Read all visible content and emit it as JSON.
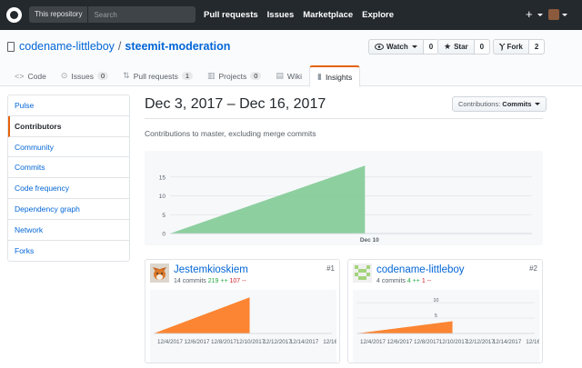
{
  "header": {
    "search_scope": "This repository",
    "search_placeholder": "Search",
    "nav": [
      "Pull requests",
      "Issues",
      "Marketplace",
      "Explore"
    ],
    "plus_icon": "plus-icon",
    "avatar_icon": "user-avatar"
  },
  "repo": {
    "owner": "codename-littleboy",
    "separator": "/",
    "name": "steemit-moderation",
    "watch_label": "Watch",
    "watch_count": "0",
    "star_label": "Star",
    "star_count": "0",
    "fork_label": "Fork",
    "fork_count": "2"
  },
  "tabs": [
    {
      "label": "Code",
      "icon": "code-icon",
      "count": null
    },
    {
      "label": "Issues",
      "icon": "issue-icon",
      "count": "0"
    },
    {
      "label": "Pull requests",
      "icon": "pull-request-icon",
      "count": "1"
    },
    {
      "label": "Projects",
      "icon": "project-icon",
      "count": "0"
    },
    {
      "label": "Wiki",
      "icon": "book-icon",
      "count": null
    },
    {
      "label": "Insights",
      "icon": "graph-icon",
      "count": null,
      "active": true
    }
  ],
  "sidebar": {
    "items": [
      {
        "label": "Pulse"
      },
      {
        "label": "Contributors",
        "selected": true
      },
      {
        "label": "Community"
      },
      {
        "label": "Commits"
      },
      {
        "label": "Code frequency"
      },
      {
        "label": "Dependency graph"
      },
      {
        "label": "Network"
      },
      {
        "label": "Forks"
      }
    ]
  },
  "main": {
    "date_range": "Dec 3, 2017 – Dec 16, 2017",
    "contrib_label": "Contributions:",
    "contrib_value": "Commits",
    "subtitle": "Contributions to master, excluding merge commits"
  },
  "colors": {
    "accent": "#e36209",
    "link": "#0366d6",
    "main_area": "#7bc88f",
    "user_area": "#fb8532",
    "additions": "#28a745",
    "deletions": "#cb2431"
  },
  "chart_data": [
    {
      "type": "area",
      "title": "",
      "x": [
        "2017-12-03",
        "2017-12-10"
      ],
      "y": [
        0,
        18
      ],
      "x_tick_labels": [
        "Dec 10"
      ],
      "y_ticks": [
        0,
        5,
        10,
        15
      ],
      "ylim": [
        0,
        20
      ],
      "grid": true
    },
    {
      "type": "area",
      "name": "Jestemkioskiem",
      "x": [
        "2017-12-03",
        "2017-12-10"
      ],
      "y": [
        0,
        14
      ],
      "x_tick_labels": [
        "12/4/2017",
        "12/6/2017",
        "12/8/2017",
        "12/10/2017",
        "12/12/2017",
        "12/14/2017",
        "12/16/"
      ]
    },
    {
      "type": "area",
      "name": "codename-littleboy",
      "x": [
        "2017-12-03",
        "2017-12-10"
      ],
      "y": [
        0,
        4
      ],
      "y_ticks": [
        5,
        10
      ],
      "x_tick_labels": [
        "12/4/2017",
        "12/6/2017",
        "12/8/2017",
        "12/10/2017",
        "12/12/2017",
        "12/14/2017",
        "12/16/"
      ]
    }
  ],
  "contributors": [
    {
      "name": "Jestemkioskiem",
      "rank": "#1",
      "commits": "14 commits",
      "additions": "219 ++",
      "deletions": "107 --"
    },
    {
      "name": "codename-littleboy",
      "rank": "#2",
      "commits": "4 commits",
      "additions": "4 ++",
      "deletions": "1 --"
    }
  ]
}
